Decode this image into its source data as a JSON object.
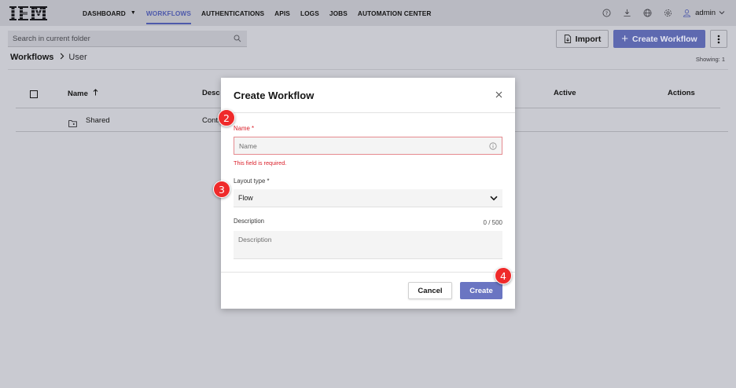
{
  "brand": {
    "logo_text": "IBM"
  },
  "nav": {
    "items": [
      "DASHBOARD",
      "WORKFLOWS",
      "AUTHENTICATIONS",
      "APIS",
      "LOGS",
      "JOBS",
      "AUTOMATION CENTER"
    ],
    "active": "WORKFLOWS",
    "user": "admin",
    "icons": [
      "help-icon",
      "download-icon",
      "globe-icon",
      "settings-icon",
      "user-icon"
    ]
  },
  "toolbar": {
    "search_placeholder": "Search in current folder",
    "import_label": "Import",
    "create_label": "Create Workflow"
  },
  "breadcrumb": {
    "root": "Workflows",
    "current": "User"
  },
  "showing": "Showing: 1",
  "table": {
    "columns": [
      "Name",
      "Desc",
      "Active",
      "Actions"
    ],
    "rows": [
      {
        "name": "Shared",
        "description": "Conta"
      }
    ]
  },
  "modal": {
    "title": "Create Workflow",
    "name_label": "Name",
    "required_mark": "*",
    "name_placeholder": "Name",
    "name_error": "This field is required.",
    "layout_label": "Layout type",
    "layout_value": "Flow",
    "description_label": "Description",
    "description_counter": "0 / 500",
    "description_placeholder": "Description",
    "cancel_label": "Cancel",
    "create_label": "Create"
  },
  "markers": [
    "2",
    "3",
    "4"
  ],
  "colors": {
    "accent": "#4e5aab",
    "primary_button": "#6a75c2",
    "error": "#da1e28",
    "marker": "#ef2a2a"
  }
}
